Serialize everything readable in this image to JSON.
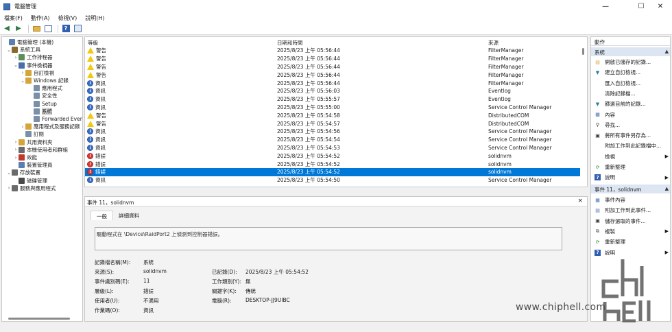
{
  "window": {
    "title": "電腦管理",
    "controls": {
      "minimize": "—",
      "maximize": "☐",
      "close": "✕"
    }
  },
  "menu": [
    "檔案(F)",
    "動作(A)",
    "檢視(V)",
    "說明(H)"
  ],
  "toolbar": {
    "icons": [
      "back-arrow-icon",
      "forward-arrow-icon",
      "folder-up-icon",
      "show-hide-tree-icon",
      "help-icon",
      "properties-icon"
    ]
  },
  "tree": [
    {
      "label": "電腦管理 (本機)",
      "exp": "",
      "indent": 0,
      "color": "#5a7fb0"
    },
    {
      "label": "系統工具",
      "exp": "⌄",
      "indent": 1,
      "color": "#8a6b2c"
    },
    {
      "label": "工作排程器",
      "exp": "›",
      "indent": 2,
      "color": "#5a8f5a"
    },
    {
      "label": "事件檢視器",
      "exp": "⌄",
      "indent": 2,
      "color": "#4a6ea9"
    },
    {
      "label": "自訂檢視",
      "exp": "›",
      "indent": 3,
      "color": "#d4a63a"
    },
    {
      "label": "Windows 記錄",
      "exp": "⌄",
      "indent": 3,
      "color": "#d4a63a"
    },
    {
      "label": "應用程式",
      "exp": "",
      "indent": 4,
      "color": "#7a8fa8"
    },
    {
      "label": "安全性",
      "exp": "",
      "indent": 4,
      "color": "#7a8fa8"
    },
    {
      "label": "Setup",
      "exp": "",
      "indent": 4,
      "color": "#7a8fa8"
    },
    {
      "label": "系統",
      "exp": "",
      "indent": 4,
      "color": "#7a8fa8",
      "selected": true
    },
    {
      "label": "Forwarded Even",
      "exp": "",
      "indent": 4,
      "color": "#7a8fa8"
    },
    {
      "label": "應用程式及服務記錄",
      "exp": "›",
      "indent": 3,
      "color": "#d4a63a"
    },
    {
      "label": "訂閱",
      "exp": "",
      "indent": 3,
      "color": "#7a8fa8"
    },
    {
      "label": "共用資料夾",
      "exp": "›",
      "indent": 2,
      "color": "#d4a63a"
    },
    {
      "label": "本機使用者和群組",
      "exp": "›",
      "indent": 2,
      "color": "#6b6b6b"
    },
    {
      "label": "效能",
      "exp": "›",
      "indent": 2,
      "color": "#c0392b"
    },
    {
      "label": "裝置管理員",
      "exp": "",
      "indent": 2,
      "color": "#5a7fb0"
    },
    {
      "label": "存放裝置",
      "exp": "⌄",
      "indent": 1,
      "color": "#6b6b6b"
    },
    {
      "label": "磁碟管理",
      "exp": "",
      "indent": 2,
      "color": "#4a4a4a"
    },
    {
      "label": "服務與應用程式",
      "exp": "›",
      "indent": 1,
      "color": "#6b6b6b"
    }
  ],
  "events": {
    "columns": {
      "level": "等級",
      "date": "日期和時間",
      "source": "來源"
    },
    "rows": [
      {
        "level": "警告",
        "type": "warn",
        "date": "2025/8/23 上午 05:56:44",
        "source": "FilterManager"
      },
      {
        "level": "警告",
        "type": "warn",
        "date": "2025/8/23 上午 05:56:44",
        "source": "FilterManager"
      },
      {
        "level": "警告",
        "type": "warn",
        "date": "2025/8/23 上午 05:56:44",
        "source": "FilterManager"
      },
      {
        "level": "警告",
        "type": "warn",
        "date": "2025/8/23 上午 05:56:44",
        "source": "FilterManager"
      },
      {
        "level": "資訊",
        "type": "info",
        "date": "2025/8/23 上午 05:56:44",
        "source": "FilterManager"
      },
      {
        "level": "資訊",
        "type": "info",
        "date": "2025/8/23 上午 05:56:03",
        "source": "Eventlog"
      },
      {
        "level": "資訊",
        "type": "info",
        "date": "2025/8/23 上午 05:55:57",
        "source": "Eventlog"
      },
      {
        "level": "資訊",
        "type": "info",
        "date": "2025/8/23 上午 05:55:00",
        "source": "Service Control Manager"
      },
      {
        "level": "警告",
        "type": "warn",
        "date": "2025/8/23 上午 05:54:58",
        "source": "DistributedCOM"
      },
      {
        "level": "警告",
        "type": "warn",
        "date": "2025/8/23 上午 05:54:57",
        "source": "DistributedCOM"
      },
      {
        "level": "資訊",
        "type": "info",
        "date": "2025/8/23 上午 05:54:56",
        "source": "Service Control Manager"
      },
      {
        "level": "資訊",
        "type": "info",
        "date": "2025/8/23 上午 05:54:54",
        "source": "Service Control Manager"
      },
      {
        "level": "資訊",
        "type": "info",
        "date": "2025/8/23 上午 05:54:53",
        "source": "Service Control Manager"
      },
      {
        "level": "錯誤",
        "type": "err",
        "date": "2025/8/23 上午 05:54:52",
        "source": "solidnvm"
      },
      {
        "level": "錯誤",
        "type": "err",
        "date": "2025/8/23 上午 05:54:52",
        "source": "solidnvm"
      },
      {
        "level": "錯誤",
        "type": "err",
        "date": "2025/8/23 上午 05:54:52",
        "source": "solidnvm",
        "selected": true
      },
      {
        "level": "資訊",
        "type": "info",
        "date": "2025/8/23 上午 05:54:50",
        "source": "Service Control Manager"
      }
    ]
  },
  "detail": {
    "title": "事件 11，solidnvm",
    "close": "×",
    "tabs": [
      "一般",
      "詳細資料"
    ],
    "message": "驅動程式在 \\Device\\RaidPort2 上偵測到控制器錯誤。",
    "fields": {
      "log_name_label": "記錄檔名稱(M):",
      "log_name": "系統",
      "source_label": "來源(S):",
      "source": "solidnvm",
      "logged_label": "已記錄(D):",
      "logged": "2025/8/23 上午 05:54:52",
      "event_id_label": "事件識別碼(E):",
      "event_id": "11",
      "task_label": "工作類別(Y):",
      "task": "無",
      "level_label": "層級(L):",
      "level": "錯誤",
      "keywords_label": "關鍵字(K):",
      "keywords": "傳統",
      "user_label": "使用者(U):",
      "user": "不適用",
      "computer_label": "電腦(R):",
      "computer": "DESKTOP-JJ9UIBC",
      "opcode_label": "作業碼(O):",
      "opcode": "資訊"
    }
  },
  "actions": {
    "title": "動作",
    "group1": "系統",
    "group1_items": [
      {
        "label": "開啟已儲存的記錄...",
        "icon": "open-log-icon"
      },
      {
        "label": "建立自訂檢視...",
        "icon": "filter-icon"
      },
      {
        "label": "匯入自訂檢視...",
        "icon": ""
      },
      {
        "label": "清除記錄檔...",
        "icon": ""
      },
      {
        "label": "篩選目前的記錄...",
        "icon": "filter-icon"
      },
      {
        "label": "內容",
        "icon": "properties-icon"
      },
      {
        "label": "尋找...",
        "icon": "find-icon"
      },
      {
        "label": "將所有事件另存為...",
        "icon": "save-icon"
      },
      {
        "label": "附加工作到此記錄檔中...",
        "icon": ""
      },
      {
        "label": "檢視",
        "icon": "",
        "submenu": true
      },
      {
        "label": "重新整理",
        "icon": "refresh-icon"
      },
      {
        "label": "說明",
        "icon": "help-icon",
        "submenu": true
      }
    ],
    "group2": "事件 11，solidnvm",
    "group2_items": [
      {
        "label": "事件內容",
        "icon": "event-properties-icon"
      },
      {
        "label": "附加工作到此事件...",
        "icon": "attach-task-icon"
      },
      {
        "label": "儲存選取的事件...",
        "icon": "save-icon"
      },
      {
        "label": "複製",
        "icon": "copy-icon",
        "submenu": true
      },
      {
        "label": "重新整理",
        "icon": "refresh-icon"
      },
      {
        "label": "說明",
        "icon": "help-icon",
        "submenu": true
      }
    ]
  },
  "watermark": {
    "logo": "chip hell",
    "url": "www.chiphell.com"
  },
  "colors": {
    "selection": "#0078d7",
    "action_group": "#dce6f2"
  }
}
